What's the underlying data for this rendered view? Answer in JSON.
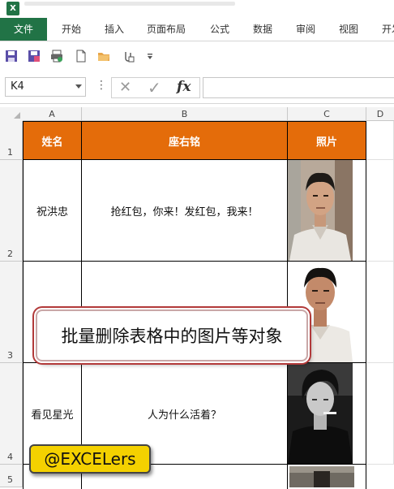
{
  "app": {
    "icon_label": "X"
  },
  "ribbon": {
    "tabs": [
      "文件",
      "开始",
      "插入",
      "页面布局",
      "公式",
      "数据",
      "审阅",
      "视图",
      "开发"
    ]
  },
  "quick_access": {
    "icons": [
      "save-icon",
      "save-as-icon",
      "print-preview-icon",
      "new-document-icon",
      "open-folder-icon",
      "attach-icon",
      "customize-dropdown-icon"
    ]
  },
  "formula_bar": {
    "name_box": "K4",
    "more_glyph": "⋮",
    "cancel_glyph": "✕",
    "enter_glyph": "✓",
    "fx_glyph": "fx",
    "formula": ""
  },
  "sheet": {
    "columns": [
      "A",
      "B",
      "C",
      "D"
    ],
    "rows": [
      "1",
      "2",
      "3",
      "4",
      "5"
    ],
    "headers": [
      "姓名",
      "座右铭",
      "照片"
    ],
    "records": [
      {
        "name": "祝洪忠",
        "motto": "抢红包，你来！发红包，我来！"
      },
      {
        "name": "",
        "motto": ""
      },
      {
        "name": "看见星光",
        "motto": "人为什么活着？"
      },
      {
        "name": "",
        "motto": ""
      }
    ],
    "header_color": "#e46c0a",
    "accent_color": "#217346"
  },
  "overlay": {
    "callout": "批量删除表格中的图片等对象",
    "badge": "@EXCELers"
  }
}
